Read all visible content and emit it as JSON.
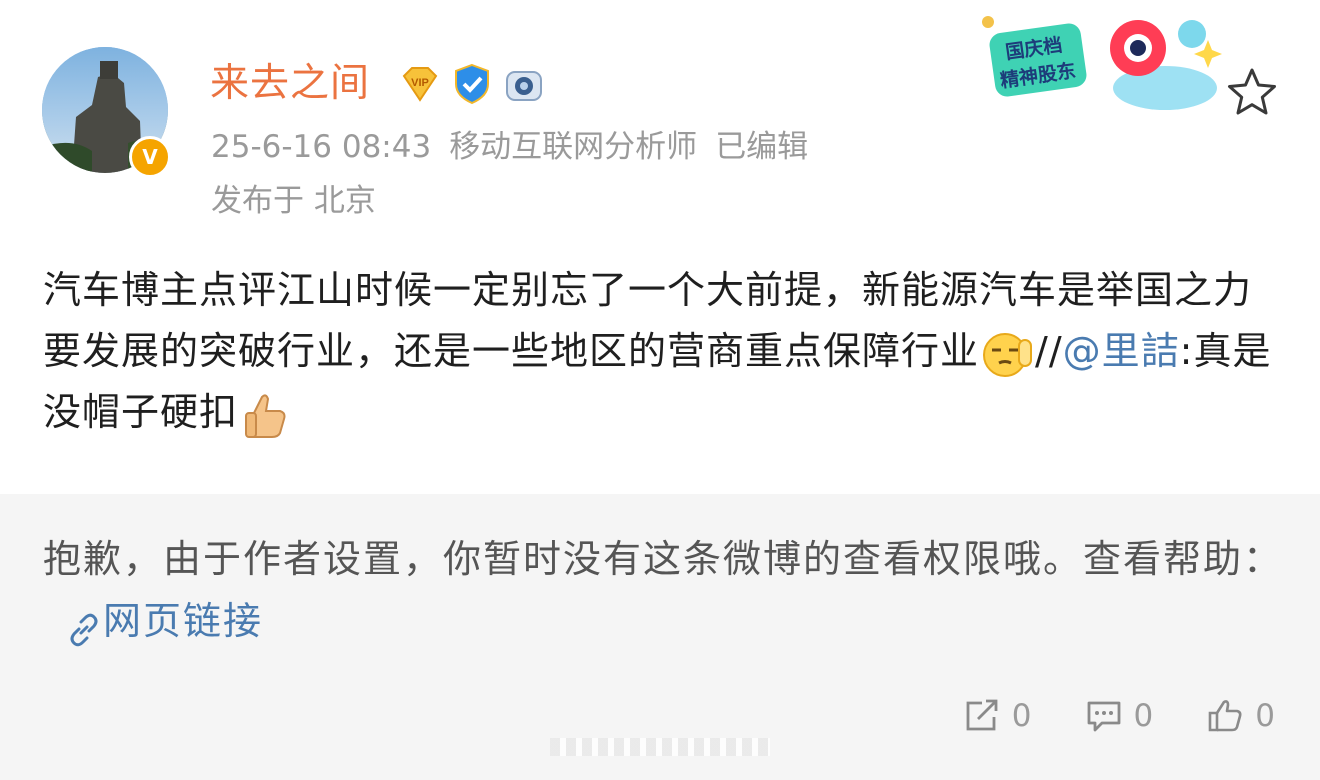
{
  "author": {
    "name": "来去之间",
    "verified_badge": "V",
    "badges": [
      "vip-diamond-icon",
      "shield-badge-icon",
      "camera-badge-icon"
    ]
  },
  "meta": {
    "timestamp": "25-6-16 08:43",
    "role": "移动互联网分析师",
    "edited": "已编辑",
    "location": "发布于 北京"
  },
  "sticker": {
    "line1": "国庆档",
    "line2": "精神股东"
  },
  "post": {
    "text_before_emoji": "汽车博主点评江山时候一定别忘了一个大前提，新能源汽车是举国之力要发展的突破行业，还是一些地区的营商重点保障行业",
    "repost_sep": "//",
    "mention": "@里詰",
    "repost_text": ":真是没帽子硬扣"
  },
  "notice": {
    "text": "抱歉，由于作者设置，你暂时没有这条微博的查看权限哦。查看帮助：",
    "link_label": "网页链接"
  },
  "actions": {
    "repost_count": "0",
    "comment_count": "0",
    "like_count": "0"
  },
  "colors": {
    "username": "#eb7340",
    "link": "#4a7bb0",
    "meta": "#9a9a9a",
    "notice_bg": "#f5f5f5"
  }
}
